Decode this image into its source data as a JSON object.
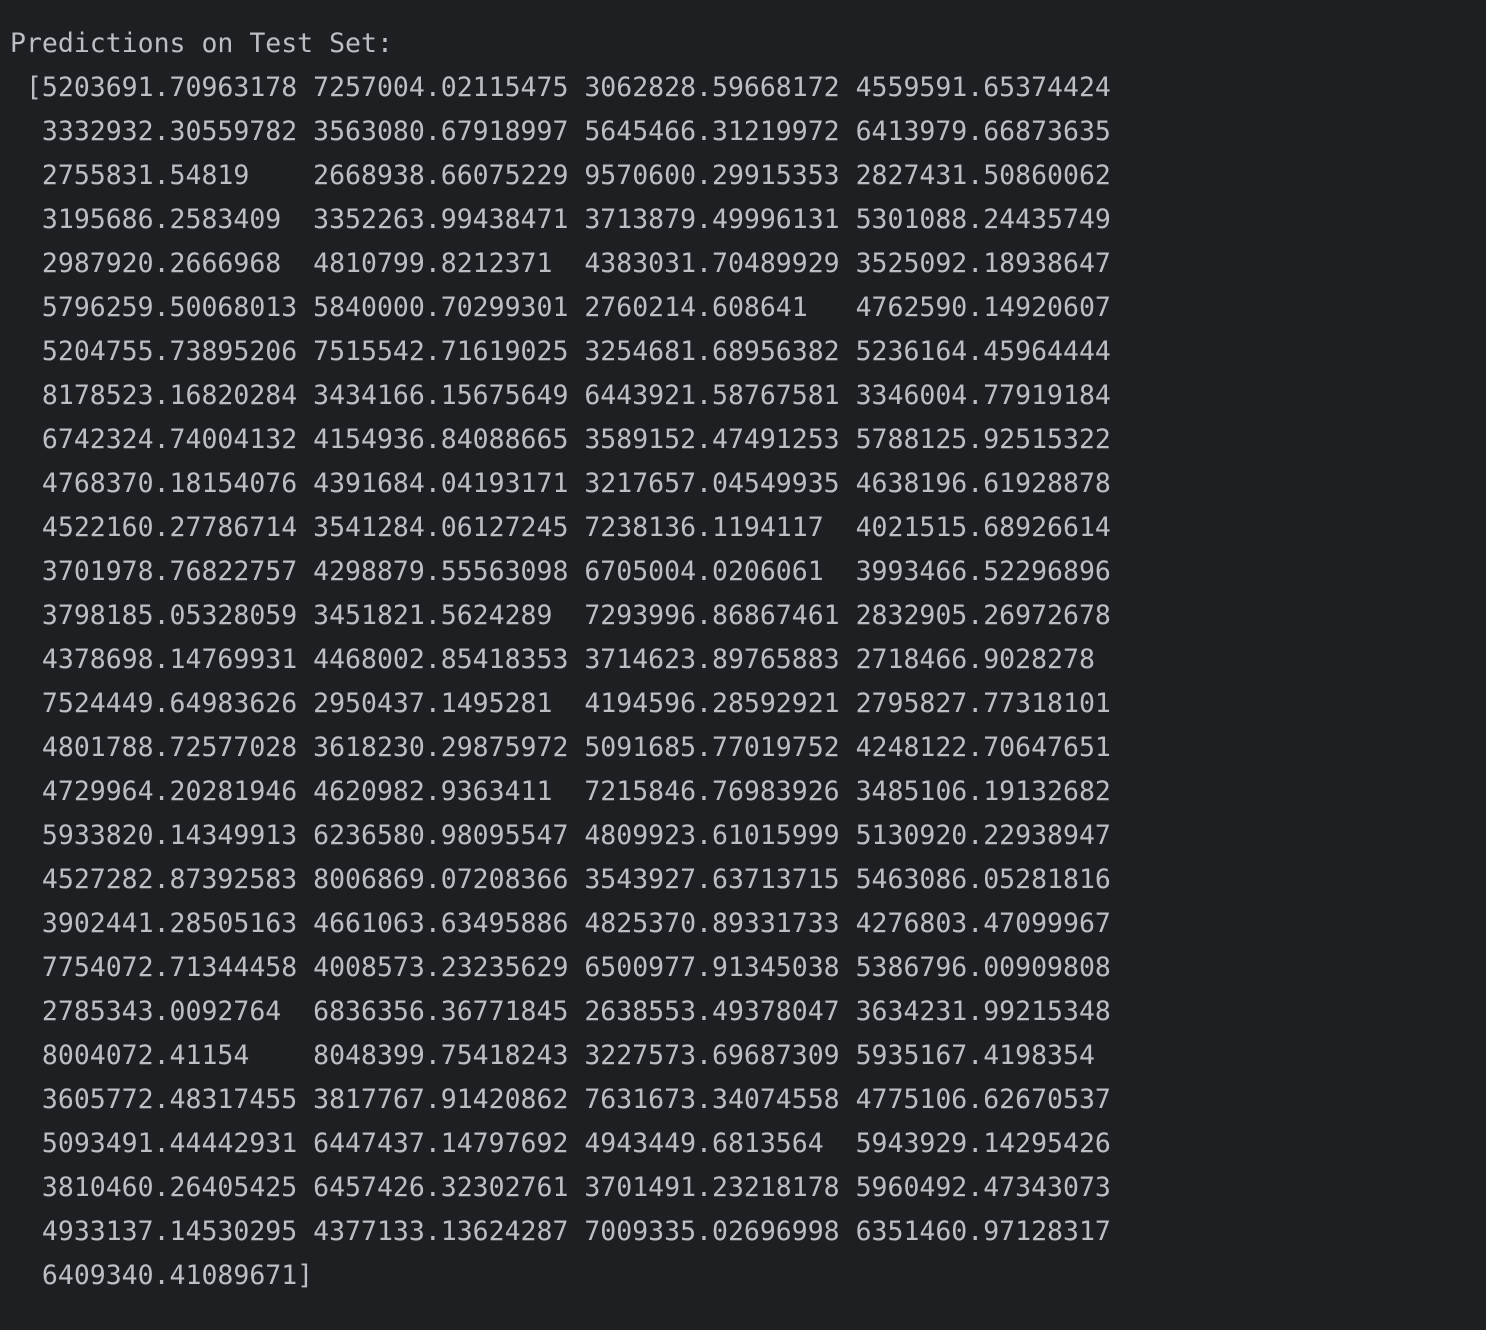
{
  "console": {
    "header": "Predictions on Test Set:",
    "lines": [
      " [5203691.70963178 7257004.02115475 3062828.59668172 4559591.65374424",
      "  3332932.30559782 3563080.67918997 5645466.31219972 6413979.66873635",
      "  2755831.54819    2668938.66075229 9570600.29915353 2827431.50860062",
      "  3195686.2583409  3352263.99438471 3713879.49996131 5301088.24435749",
      "  2987920.2666968  4810799.8212371  4383031.70489929 3525092.18938647",
      "  5796259.50068013 5840000.70299301 2760214.608641   4762590.14920607",
      "  5204755.73895206 7515542.71619025 3254681.68956382 5236164.45964444",
      "  8178523.16820284 3434166.15675649 6443921.58767581 3346004.77919184",
      "  6742324.74004132 4154936.84088665 3589152.47491253 5788125.92515322",
      "  4768370.18154076 4391684.04193171 3217657.04549935 4638196.61928878",
      "  4522160.27786714 3541284.06127245 7238136.1194117  4021515.68926614",
      "  3701978.76822757 4298879.55563098 6705004.0206061  3993466.52296896",
      "  3798185.05328059 3451821.5624289  7293996.86867461 2832905.26972678",
      "  4378698.14769931 4468002.85418353 3714623.89765883 2718466.9028278",
      "  7524449.64983626 2950437.1495281  4194596.28592921 2795827.77318101",
      "  4801788.72577028 3618230.29875972 5091685.77019752 4248122.70647651",
      "  4729964.20281946 4620982.9363411  7215846.76983926 3485106.19132682",
      "  5933820.14349913 6236580.98095547 4809923.61015999 5130920.22938947",
      "  4527282.87392583 8006869.07208366 3543927.63713715 5463086.05281816",
      "  3902441.28505163 4661063.63495886 4825370.89331733 4276803.47099967",
      "  7754072.71344458 4008573.23235629 6500977.91345038 5386796.00909808",
      "  2785343.0092764  6836356.36771845 2638553.49378047 3634231.99215348",
      "  8004072.41154    8048399.75418243 3227573.69687309 5935167.4198354",
      "  3605772.48317455 3817767.91420862 7631673.34074558 4775106.62670537",
      "  5093491.44442931 6447437.14797692 4943449.6813564  5943929.14295426",
      "  3810460.26405425 6457426.32302761 3701491.23218178 5960492.47343073",
      "  4933137.14530295 4377133.13624287 7009335.02696998 6351460.97128317",
      "  6409340.41089671]"
    ]
  },
  "colors": {
    "background": "#1e1f22",
    "text": "#bcbec4"
  }
}
